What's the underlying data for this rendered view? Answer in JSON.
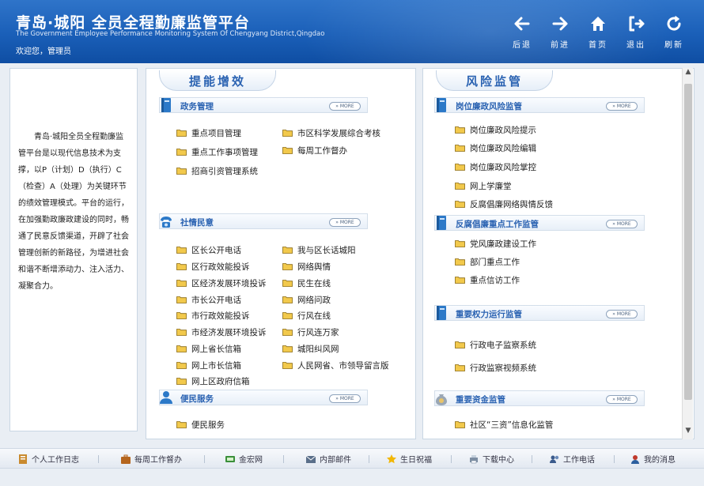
{
  "header": {
    "title": "青岛·城阳  全员全程勤廉监管平台",
    "subtitle": "The Government Employee Performance Monitoring System Of Chengyang District,Qingdao",
    "welcome": "欢迎您，管理员",
    "nav": [
      {
        "label": "后退",
        "icon": "arrow-left-icon"
      },
      {
        "label": "前进",
        "icon": "arrow-right-icon"
      },
      {
        "label": "首页",
        "icon": "home-icon"
      },
      {
        "label": "退出",
        "icon": "exit-icon"
      },
      {
        "label": "刷新",
        "icon": "refresh-icon"
      }
    ]
  },
  "intro": "　　青岛·城阳全员全程勤廉监管平台是以现代信息技术为支撑，以P（计划）D（执行）C（检查）A（处理）为关键环节的绩效管理模式。平台的运行，在加强勤政廉政建设的同时，畅通了民意反馈渠道，开辟了社会管理创新的新路径，为增进社会和谐不断增添动力、注入活力、凝聚合力。",
  "more_label": "» MORE",
  "center": {
    "title": "提能增效",
    "sections": [
      {
        "title": "政务管理",
        "icon": "book-icon",
        "items": [
          "重点项目管理",
          "市区科学发展综合考核",
          "重点工作事项管理",
          "每周工作督办",
          "招商引资管理系统"
        ]
      },
      {
        "title": "社情民意",
        "icon": "telephone-icon",
        "items": [
          "区长公开电话",
          "我与区长话城阳",
          "区行政效能投诉",
          "网络舆情",
          "区经济发展环境投诉",
          "民生在线",
          "市长公开电话",
          "网络问政",
          "市行政效能投诉",
          "行风在线",
          "市经济发展环境投诉",
          "行风连万家",
          "网上省长信箱",
          "城阳纠风网",
          "网上市长信箱",
          "人民网省、市领导留言版",
          "网上区政府信箱"
        ]
      },
      {
        "title": "便民服务",
        "icon": "person-icon",
        "items": [
          "便民服务"
        ]
      }
    ]
  },
  "right": {
    "title": "风险监管",
    "sections": [
      {
        "title": "岗位廉政风险监管",
        "icon": "book-icon",
        "items": [
          "岗位廉政风险提示",
          "岗位廉政风险编辑",
          "岗位廉政风险掌控",
          "网上学廉堂",
          "反腐倡廉网络舆情反馈"
        ]
      },
      {
        "title": "反腐倡廉重点工作监管",
        "icon": "book-icon",
        "items": [
          "党风廉政建设工作",
          "部门重点工作",
          "重点信访工作"
        ]
      },
      {
        "title": "重要权力运行监管",
        "icon": "book-icon",
        "items": [
          "行政电子监察系统",
          "行政监察视频系统"
        ]
      },
      {
        "title": "重要资金监管",
        "icon": "coin-bag-icon",
        "items": [
          "社区“三资”信息化监管"
        ]
      }
    ]
  },
  "footer": [
    {
      "label": "个人工作日志",
      "icon": "notebook-icon"
    },
    {
      "label": "每周工作督办",
      "icon": "briefcase-icon"
    },
    {
      "label": "金宏网",
      "icon": "network-icon"
    },
    {
      "label": "内部邮件",
      "icon": "mail-icon"
    },
    {
      "label": "生日祝福",
      "icon": "star-icon"
    },
    {
      "label": "下载中心",
      "icon": "printer-icon"
    },
    {
      "label": "工作电话",
      "icon": "users-icon"
    },
    {
      "label": "我的消息",
      "icon": "message-icon"
    }
  ],
  "colors": {
    "header_blue": "#1a5fb8",
    "title_blue": "#2b63b2",
    "folder_yellow": "#f2c94c"
  }
}
